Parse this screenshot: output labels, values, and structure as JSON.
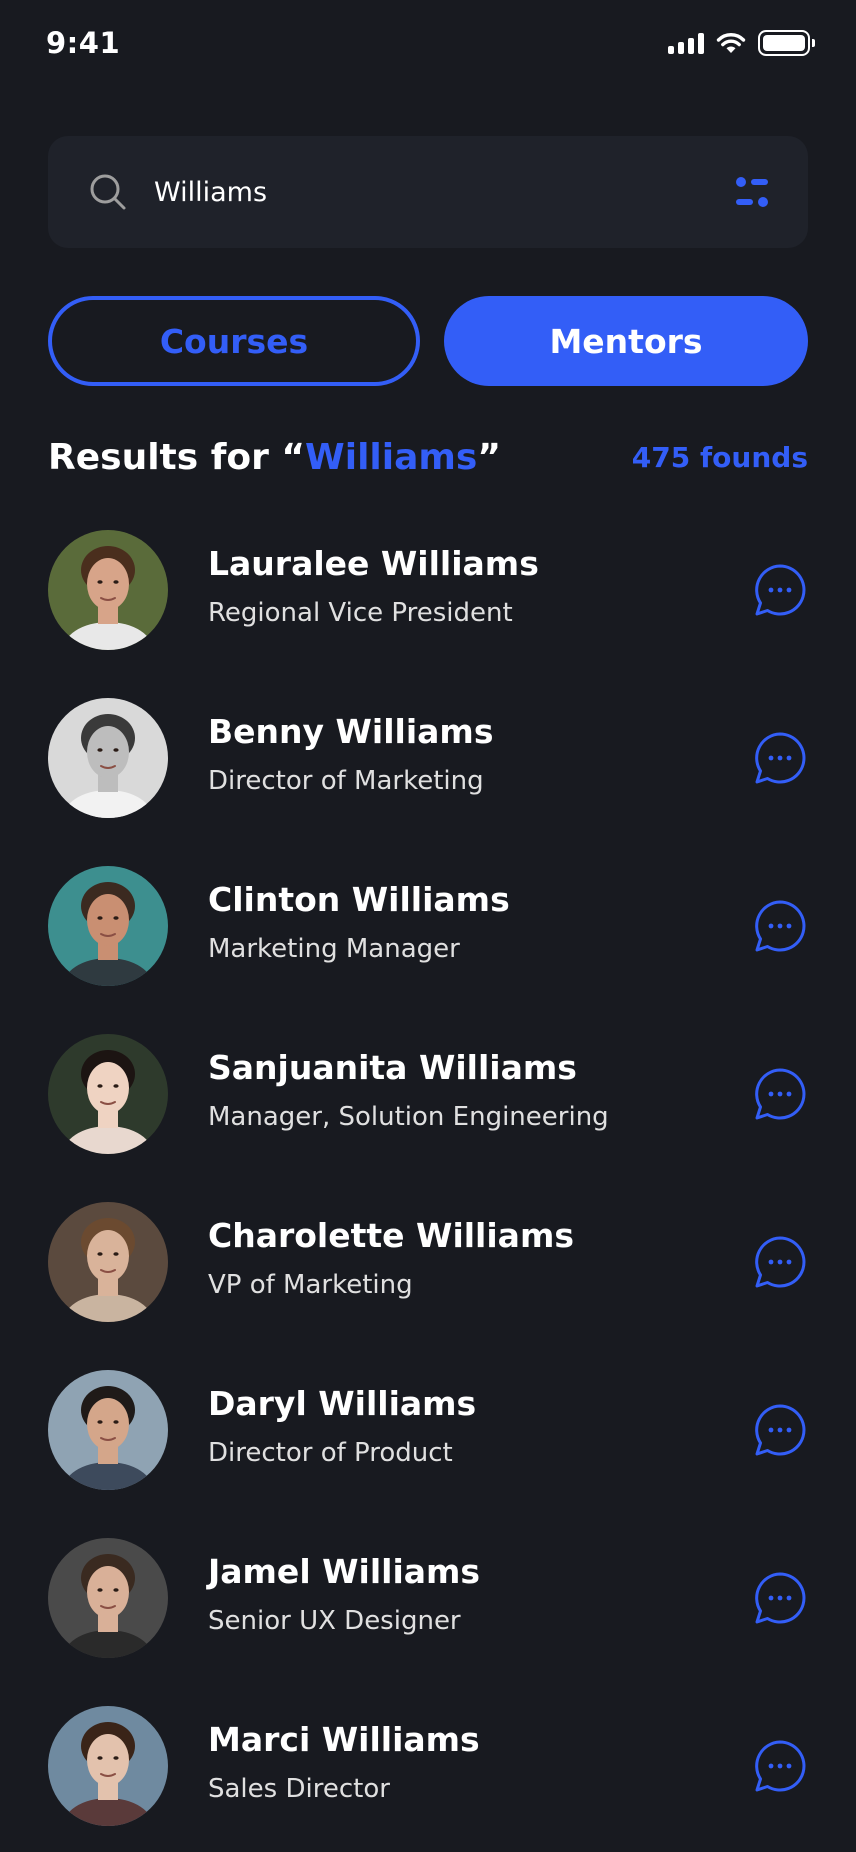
{
  "status_bar": {
    "time": "9:41"
  },
  "search": {
    "value": "Williams",
    "placeholder": "Search"
  },
  "tabs": [
    {
      "label": "Courses",
      "active": false
    },
    {
      "label": "Mentors",
      "active": true
    }
  ],
  "results": {
    "prefix": "Results for “",
    "query": "Williams",
    "suffix": "”",
    "count_label": "475 founds"
  },
  "colors": {
    "accent": "#335ef7",
    "background": "#181a20",
    "surface": "#1f222a"
  },
  "mentors": [
    {
      "name": "Lauralee Williams",
      "role": "Regional Vice President",
      "avatar": {
        "bg": "#5a6b3a",
        "skin": "#d7a489",
        "hair": "#4a2e1d",
        "shirt": "#e8e8e8"
      }
    },
    {
      "name": "Benny Williams",
      "role": "Director of Marketing",
      "avatar": {
        "bg": "#d9d9d9",
        "skin": "#bdbdbd",
        "hair": "#3a3a3a",
        "shirt": "#f2f2f2"
      }
    },
    {
      "name": "Clinton Williams",
      "role": "Marketing Manager",
      "avatar": {
        "bg": "#3d8f8f",
        "skin": "#c98f72",
        "hair": "#3b2a20",
        "shirt": "#2f3a40"
      }
    },
    {
      "name": "Sanjuanita Williams",
      "role": "Manager, Solution Engineering",
      "avatar": {
        "bg": "#2e3a2c",
        "skin": "#efd3c2",
        "hair": "#1c1412",
        "shirt": "#e8d8cf"
      }
    },
    {
      "name": "Charolette Williams",
      "role": "VP of Marketing",
      "avatar": {
        "bg": "#5b4a3e",
        "skin": "#d9b39a",
        "hair": "#6b4a30",
        "shirt": "#c9b4a0"
      }
    },
    {
      "name": "Daryl Williams",
      "role": "Director of Product",
      "avatar": {
        "bg": "#8fa3b3",
        "skin": "#d4a68a",
        "hair": "#1f1a18",
        "shirt": "#3d4a5c"
      }
    },
    {
      "name": "Jamel Williams",
      "role": "Senior UX Designer",
      "avatar": {
        "bg": "#4a4a4a",
        "skin": "#d9b098",
        "hair": "#3a2a20",
        "shirt": "#2a2a2a"
      }
    },
    {
      "name": "Marci Williams",
      "role": "Sales Director",
      "avatar": {
        "bg": "#6f8aa0",
        "skin": "#e3c2ad",
        "hair": "#3a2418",
        "shirt": "#5a3a3a"
      }
    }
  ]
}
